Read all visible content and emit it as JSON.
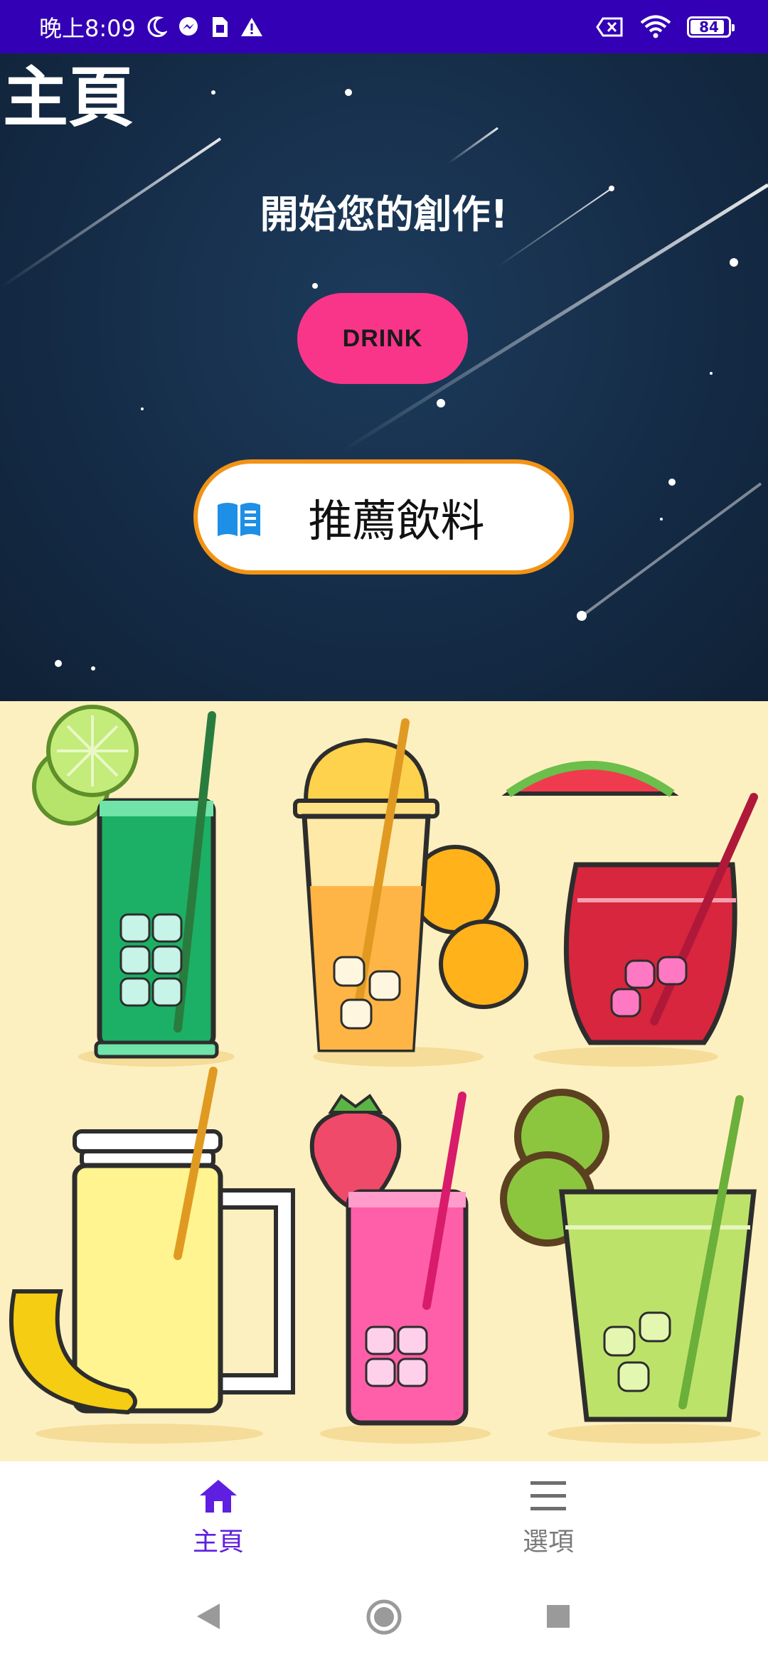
{
  "status_bar": {
    "time": "晚上8:09",
    "battery_level": "84",
    "background_color": "#3300b5",
    "icons": [
      "moon-icon",
      "messenger-icon",
      "sim-icon",
      "warning-icon",
      "no-sim-icon",
      "wifi-icon",
      "battery-icon"
    ]
  },
  "header": {
    "title": "主頁",
    "tagline": "開始您的創作!"
  },
  "actions": {
    "drink_label": "DRINK",
    "drink_color": "#f9358a",
    "recommend_label": "推薦飲料",
    "recommend_border_color": "#f29315",
    "recommend_icon": "book-icon"
  },
  "bottom_nav": {
    "items": [
      {
        "label": "主頁",
        "icon": "home-icon",
        "selected": true
      },
      {
        "label": "選項",
        "icon": "menu-icon",
        "selected": false
      }
    ],
    "accent_color": "#5e1fe0"
  },
  "system_nav": {
    "icons": [
      "back-icon",
      "home-circle-icon",
      "recents-icon"
    ]
  }
}
